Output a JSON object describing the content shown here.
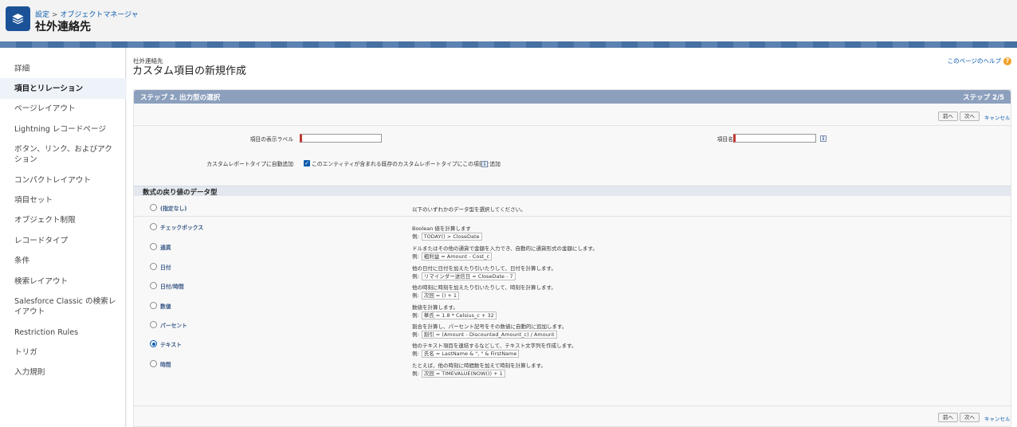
{
  "header": {
    "breadcrumb": {
      "setup": "設定",
      "separator": ">",
      "object_manager": "オブジェクトマネージャ"
    },
    "object_title": "社外連絡先",
    "app_icon": "layers-icon"
  },
  "sidebar": {
    "items": [
      {
        "label": "詳細"
      },
      {
        "label": "項目とリレーション",
        "active": true
      },
      {
        "label": "ページレイアウト"
      },
      {
        "label": "Lightning レコードページ"
      },
      {
        "label": "ボタン、リンク、およびアクション"
      },
      {
        "label": "コンパクトレイアウト"
      },
      {
        "label": "項目セット"
      },
      {
        "label": "オブジェクト制限"
      },
      {
        "label": "レコードタイプ"
      },
      {
        "label": "条件"
      },
      {
        "label": "検索レイアウト"
      },
      {
        "label": "Salesforce Classic の検索レイアウト"
      },
      {
        "label": "Restriction Rules"
      },
      {
        "label": "トリガ"
      },
      {
        "label": "入力規則"
      }
    ]
  },
  "page": {
    "subtitle": "社外連絡先",
    "title": "カスタム項目の新規作成",
    "help_link": "このページのヘルプ",
    "help_icon": "question-icon"
  },
  "step": {
    "title": "ステップ 2. 出力型の選択",
    "count": "ステップ 2/5"
  },
  "buttons": {
    "prev": "前へ",
    "next": "次へ",
    "cancel": "キャンセル"
  },
  "form": {
    "field_label_label": "項目の表示ラベル",
    "field_label_value": "",
    "field_name_label": "項目名",
    "field_name_value": "",
    "report_type_label": "カスタムレポートタイプに自動追加",
    "report_type_checked": true,
    "report_type_text": "このエンティティが含まれる既存のカスタムレポートタイプにこの項目を追加",
    "info_icon": "info-icon"
  },
  "return_type": {
    "section_title": "数式の戻り値のデータ型",
    "example_prefix": "例:",
    "selected": "テキスト",
    "options": [
      {
        "label": "(指定なし)",
        "desc": "以下のいずれかのデータ型を選択してください。",
        "example": ""
      },
      {
        "label": "チェックボックス",
        "desc": "Boolean 値を計算します",
        "example": "TODAY() > CloseDate"
      },
      {
        "label": "通貨",
        "desc": "ドルまたはその他の通貨で金額を入力でき、自動的に通貨形式の金額にします。",
        "example": "粗利益 = Amount - Cost_c"
      },
      {
        "label": "日付",
        "desc": "他の日付に日付を加えたり引いたりして、日付を計算します。",
        "example": "リマインダー送信日 = CloseDate - 7"
      },
      {
        "label": "日付/時間",
        "desc": "他の時刻に時刻を加えたり引いたりして、時刻を計算します。",
        "example": "次回 = () + 1"
      },
      {
        "label": "数値",
        "desc": "数値を計算します。",
        "example": "華氏 = 1.8 * Celsius_c + 32"
      },
      {
        "label": "パーセント",
        "desc": "割合を計算し、パーセント記号をその数値に自動的に追加します。",
        "example": "割引 = (Amount - Discounted_Amount_c) / Amount"
      },
      {
        "label": "テキスト",
        "desc": "他のテキスト項目を連結するなどして、テキスト文字列を作成します。",
        "example": "氏名 = LastName & \", \" & FirstName"
      },
      {
        "label": "時間",
        "desc": "たとえば、他の時刻に時間数を加えて時刻を計算します。",
        "example": "次回 = TIMEVALUE(NOW()) + 1"
      }
    ]
  },
  "colors": {
    "brand": "#1b5297",
    "link": "#0b5cab",
    "step_bar": "#8ca0bd",
    "required": "#c23934"
  }
}
